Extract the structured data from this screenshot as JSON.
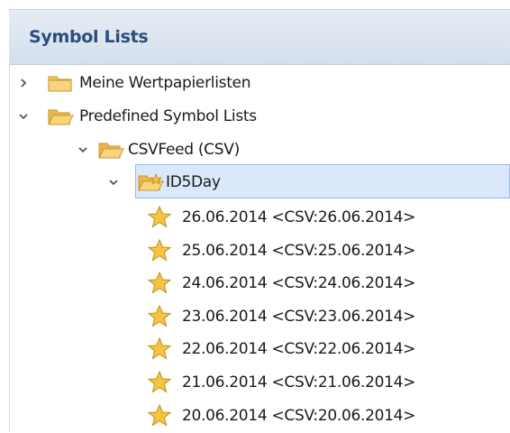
{
  "panel": {
    "title": "Symbol Lists"
  },
  "tree": {
    "nodes": [
      {
        "label": "Meine Wertpapierlisten",
        "expanded": false,
        "icon": "folder-icon"
      },
      {
        "label": "Predefined Symbol Lists",
        "expanded": true,
        "icon": "folder-open-icon"
      },
      {
        "label": "CSVFeed (CSV)",
        "expanded": true,
        "icon": "folder-open-icon"
      },
      {
        "label": "ID5Day",
        "expanded": true,
        "icon": "folder-open-star-icon",
        "selected": true
      }
    ],
    "items": [
      {
        "label": "26.06.2014 <CSV:26.06.2014>",
        "icon": "star-icon"
      },
      {
        "label": "25.06.2014 <CSV:25.06.2014>",
        "icon": "star-icon"
      },
      {
        "label": "24.06.2014 <CSV:24.06.2014>",
        "icon": "star-icon"
      },
      {
        "label": "23.06.2014 <CSV:23.06.2014>",
        "icon": "star-icon"
      },
      {
        "label": "22.06.2014 <CSV:22.06.2014>",
        "icon": "star-icon"
      },
      {
        "label": "21.06.2014 <CSV:21.06.2014>",
        "icon": "star-icon"
      },
      {
        "label": "20.06.2014 <CSV:20.06.2014>",
        "icon": "star-icon"
      }
    ]
  },
  "colors": {
    "header_text": "#2b4d7a",
    "selection_bg": "#dbe8fb",
    "selection_border": "#9ab8e0",
    "folder": "#f3c660",
    "star": "#f5c542"
  }
}
